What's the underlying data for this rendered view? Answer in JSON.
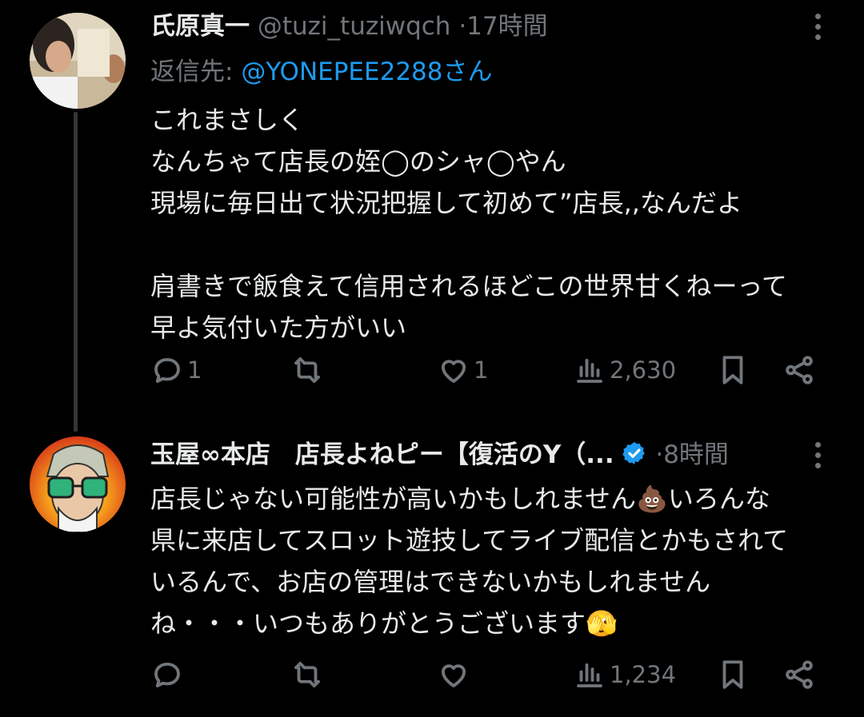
{
  "tweets": [
    {
      "name": "氏原真一",
      "handle": "@tuzi_tuziwqch",
      "dot": "·",
      "time": "17時間",
      "reply_prefix": "返信先: ",
      "reply_mention": "@YONEPEE2288さん",
      "text": "これまさしく\nなんちゃて店長の姪◯のシャ◯やん\n現場に毎日出て状況把握して初めて”店長,,なんだよ\n\n肩書きで飯食えて信用されるほどこの世界甘くねーって\n早よ気付いた方がいい",
      "actions": {
        "reply_count": "1",
        "retweet_count": "",
        "like_count": "1",
        "views": "2,630"
      }
    },
    {
      "name": "玉屋∞本店　店長よねピー【復活のY（...",
      "verified": true,
      "dot": "·",
      "time": "8時間",
      "text": "店長じゃない可能性が高いかもしれません💩いろんな\n県に来店してスロット遊技してライブ配信とかもされて\nいるんで、お店の管理はできないかもしれません\nね・・・いつもありがとうございます🫣",
      "actions": {
        "reply_count": "",
        "retweet_count": "",
        "like_count": "",
        "views": "1,234"
      }
    }
  ],
  "colors": {
    "background": "#000000",
    "text": "#e7e9ea",
    "muted": "#71767b",
    "link": "#1d9bf0",
    "verified": "#1d9bf0"
  },
  "icons": [
    "reply-icon",
    "retweet-icon",
    "like-icon",
    "views-icon",
    "bookmark-icon",
    "share-icon",
    "more-icon",
    "verified-badge-icon"
  ]
}
